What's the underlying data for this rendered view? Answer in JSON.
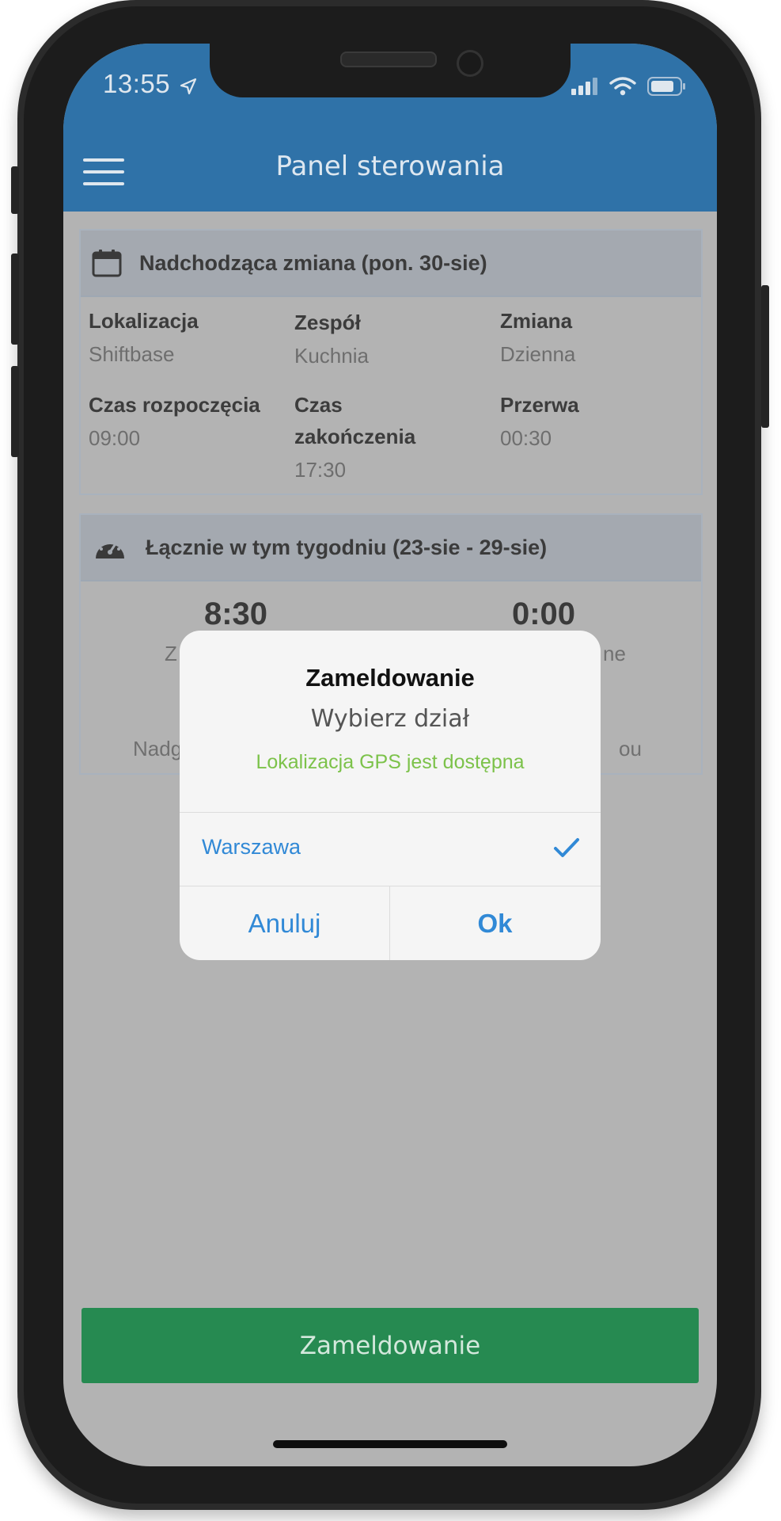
{
  "status_bar": {
    "time": "13:55"
  },
  "header": {
    "title": "Panel sterowania"
  },
  "upcoming_shift": {
    "title": "Nadchodząca zmiana (pon. 30-sie)",
    "location_label": "Lokalizacja",
    "location_value": "Shiftbase",
    "team_label": "Zespół",
    "team_value": "Kuchnia",
    "shift_label": "Zmiana",
    "shift_value": "Dzienna",
    "start_label": "Czas rozpoczęcia",
    "start_value": "09:00",
    "end_label_line1": "Czas",
    "end_label_line2": "zakończenia",
    "end_value": "17:30",
    "break_label": "Przerwa",
    "break_value": "00:30"
  },
  "weekly_total": {
    "title": "Łącznie w tym tygodniu (23-sie - 29-sie)",
    "left_value": "8:30",
    "left_frag": "Z",
    "left_bottom_frag": "Nadg",
    "right_value": "0:00",
    "right_frag": "ne",
    "right_bottom_frag": "ou"
  },
  "dialog": {
    "title": "Zameldowanie",
    "subtitle": "Wybierz dział",
    "gps_status": "Lokalizacja GPS jest dostępna",
    "option": "Warszawa",
    "cancel": "Anuluj",
    "ok": "Ok"
  },
  "checkin_button": "Zameldowanie",
  "colors": {
    "header_bg": "#2f72a8",
    "checkin_bg": "#268a51",
    "dialog_accent": "#3189d6",
    "gps_ok": "#7cc24a"
  }
}
